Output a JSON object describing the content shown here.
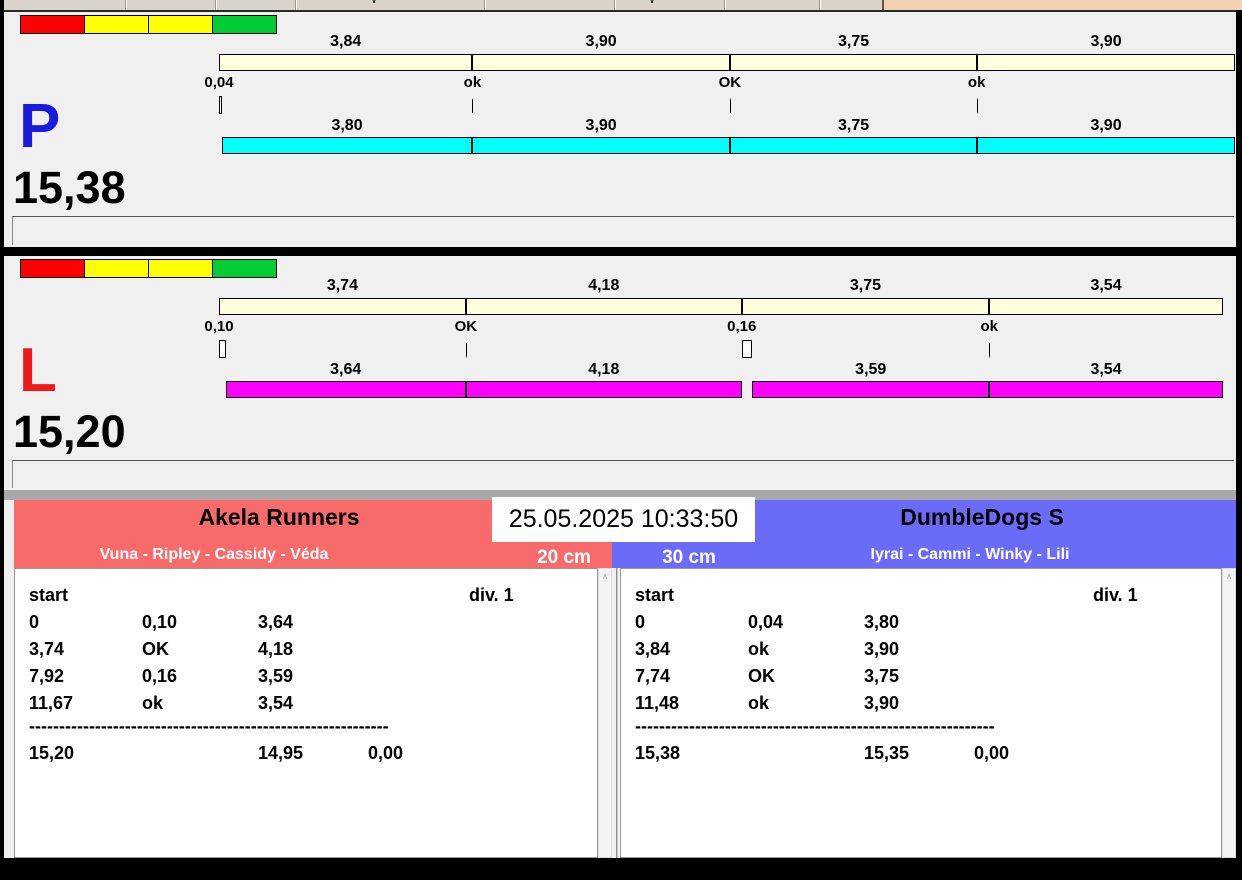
{
  "toolbar": {
    "background": "#D8D4CC",
    "tan_panel_color": "#F1D3B3",
    "chevron_icon": "∨"
  },
  "traffic_light_colors": [
    "#FF0000",
    "#FFFF00",
    "#FFFF00",
    "#00CC33"
  ],
  "lanes": [
    {
      "letter": "P",
      "letter_color": "#1B1BDE",
      "total": "15,38",
      "top_bar": {
        "color": "#FFFFE0",
        "segments": [
          {
            "label": "3,84",
            "value": 3.84
          },
          {
            "label": "3,90",
            "value": 3.9
          },
          {
            "label": "3,75",
            "value": 3.75
          },
          {
            "label": "3,90",
            "value": 3.9
          }
        ]
      },
      "markers": [
        {
          "label": "0,04",
          "type": "box",
          "t": 0,
          "value": 0.04
        },
        {
          "label": "ok",
          "type": "line",
          "t": 3.84
        },
        {
          "label": "OK",
          "type": "line",
          "t": 7.74
        },
        {
          "label": "ok",
          "type": "line",
          "t": 11.48
        }
      ],
      "bottom_bar": {
        "color": "#00FFFF",
        "blocks": [
          {
            "type": "space",
            "value": 0.04
          },
          {
            "type": "seg",
            "label": "3,80",
            "value": 3.8
          },
          {
            "type": "seg",
            "label": "3,90",
            "value": 3.9
          },
          {
            "type": "seg",
            "label": "3,75",
            "value": 3.75
          },
          {
            "type": "seg",
            "label": "3,90",
            "value": 3.9
          }
        ]
      }
    },
    {
      "letter": "L",
      "letter_color": "#EE1A1A",
      "total": "15,20",
      "top_bar": {
        "color": "#FFFFE0",
        "segments": [
          {
            "label": "3,74",
            "value": 3.74
          },
          {
            "label": "4,18",
            "value": 4.18
          },
          {
            "label": "3,75",
            "value": 3.75
          },
          {
            "label": "3,54",
            "value": 3.54
          }
        ]
      },
      "markers": [
        {
          "label": "0,10",
          "type": "box",
          "t": 0,
          "value": 0.1
        },
        {
          "label": "OK",
          "type": "line",
          "t": 3.74
        },
        {
          "label": "0,16",
          "type": "box",
          "t": 7.92,
          "value": 0.16
        },
        {
          "label": "ok",
          "type": "line",
          "t": 11.67
        }
      ],
      "bottom_bar": {
        "color": "#FF00FF",
        "blocks": [
          {
            "type": "space",
            "value": 0.1
          },
          {
            "type": "seg",
            "label": "3,64",
            "value": 3.64
          },
          {
            "type": "seg",
            "label": "4,18",
            "value": 4.18
          },
          {
            "type": "space",
            "value": 0.16
          },
          {
            "type": "seg",
            "label": "3,59",
            "value": 3.59
          },
          {
            "type": "seg",
            "label": "3,54",
            "value": 3.54
          }
        ]
      }
    }
  ],
  "clock": "25.05.2025 10:33:50",
  "teams": {
    "left": {
      "name": "Akela Runners",
      "dogs": "Vuna - Ripley - Cassidy - Véda",
      "height": "20 cm",
      "header_color": "#F96B6B",
      "log": {
        "start_label": "start",
        "division": "div. 1",
        "rows": [
          [
            "0",
            "0,10",
            "3,64"
          ],
          [
            "3,74",
            "OK",
            "4,18"
          ],
          [
            "7,92",
            "0,16",
            "3,59"
          ],
          [
            "11,67",
            "ok",
            "3,54"
          ]
        ],
        "separator": "------------------------------------------------------------",
        "totals": [
          "15,20",
          "14,95",
          "0,00"
        ]
      }
    },
    "right": {
      "name": "DumbleDogs S",
      "dogs": "Iyrai - Cammi - Winky - Lili",
      "height": "30 cm",
      "header_color": "#6B6BF9",
      "log": {
        "start_label": "start",
        "division": "div. 1",
        "rows": [
          [
            "0",
            "0,04",
            "3,80"
          ],
          [
            "3,84",
            "ok",
            "3,90"
          ],
          [
            "7,74",
            "OK",
            "3,75"
          ],
          [
            "11,48",
            "ok",
            "3,90"
          ]
        ],
        "separator": "------------------------------------------------------------",
        "totals": [
          "15,38",
          "15,35",
          "0,00"
        ]
      }
    }
  },
  "scroll_up_icon": "∧"
}
